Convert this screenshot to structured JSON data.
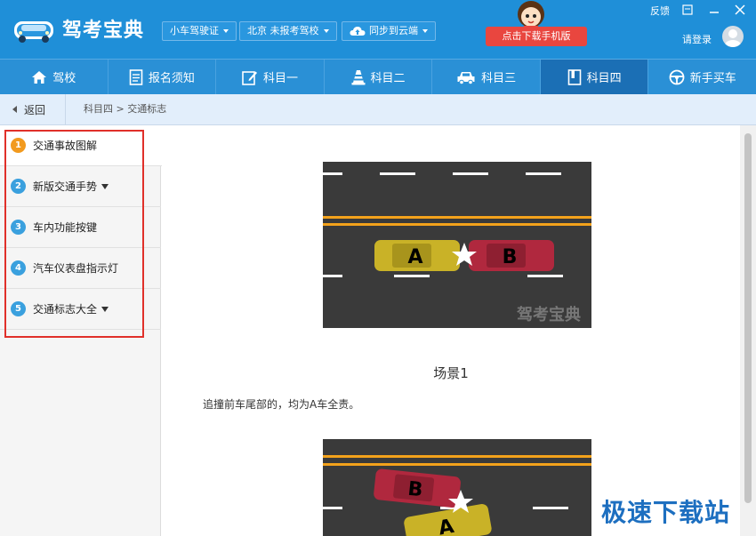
{
  "app": {
    "logo_text": "驾考宝典",
    "license_dropdown": "小车驾驶证",
    "location_dropdown": "北京 未报考驾校",
    "sync_dropdown": "同步到云端",
    "download_mobile": "点击下载手机版",
    "feedback": "反馈",
    "login": "请登录"
  },
  "nav": {
    "items": [
      {
        "label": "驾校",
        "icon": "home-icon"
      },
      {
        "label": "报名须知",
        "icon": "document-icon"
      },
      {
        "label": "科目一",
        "icon": "edit-icon"
      },
      {
        "label": "科目二",
        "icon": "cone-icon"
      },
      {
        "label": "科目三",
        "icon": "car-icon"
      },
      {
        "label": "科目四",
        "icon": "book-icon",
        "active": true
      },
      {
        "label": "新手买车",
        "icon": "steering-wheel-icon"
      }
    ]
  },
  "breadcrumb": {
    "back": "返回",
    "path": "科目四 > 交通标志"
  },
  "sidebar": {
    "items": [
      {
        "num": "1",
        "label": "交通事故图解",
        "active": true
      },
      {
        "num": "2",
        "label": "新版交通手势",
        "has_dropdown": true
      },
      {
        "num": "3",
        "label": "车内功能按键"
      },
      {
        "num": "4",
        "label": "汽车仪表盘指示灯"
      },
      {
        "num": "5",
        "label": "交通标志大全",
        "has_dropdown": true
      }
    ]
  },
  "content": {
    "image_watermark": "驾考宝典",
    "car_a": "A",
    "car_b": "B",
    "scene_title": "场景1",
    "scene_desc": "追撞前车尾部的，均为A车全责。",
    "car_a2": "A",
    "car_b2": "B"
  },
  "colors": {
    "header_blue": "#1f8fd8",
    "nav_active": "#1b6fb5",
    "download_red": "#e9463f",
    "highlight_box": "#e0302a",
    "step_orange": "#f29a1e",
    "step_blue": "#3aa0de"
  },
  "site_watermark": "极速下载站"
}
